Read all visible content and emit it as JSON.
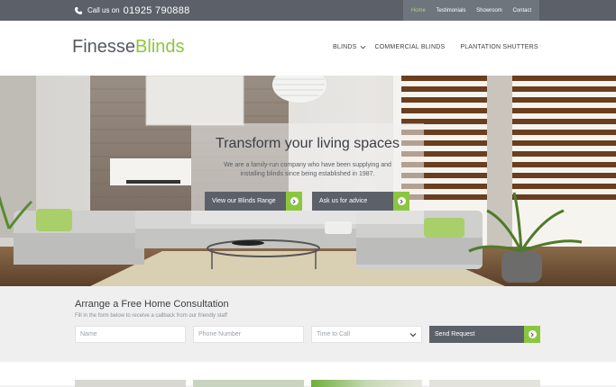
{
  "topbar": {
    "call_label": "Call us on",
    "phone_number": "01925 790888",
    "nav": [
      {
        "label": "Home",
        "active": true
      },
      {
        "label": "Testimonials",
        "active": false
      },
      {
        "label": "Showroom",
        "active": false
      },
      {
        "label": "Contact",
        "active": false
      }
    ]
  },
  "header": {
    "logo_part1": "Finesse",
    "logo_part2": "Blinds",
    "nav": [
      "BLINDS",
      "COMMERCIAL BLINDS",
      "PLANTATION SHUTTERS"
    ]
  },
  "hero": {
    "heading": "Transform your living spaces",
    "subtext": "We are a family-run company who have been supplying and installing blinds since being established in 1987.",
    "button_primary": "View our Blinds Range",
    "button_secondary": "Ask us for advice"
  },
  "consult": {
    "title": "Arrange a Free Home Consultation",
    "description": "Fill in the form below to receive a callback from our friendly staff",
    "name_placeholder": "Name",
    "phone_placeholder": "Phone Number",
    "time_placeholder": "Time to Call",
    "submit_label": "Send Request"
  },
  "colors": {
    "accent": "#8cc63f",
    "dark": "#5c6169"
  }
}
